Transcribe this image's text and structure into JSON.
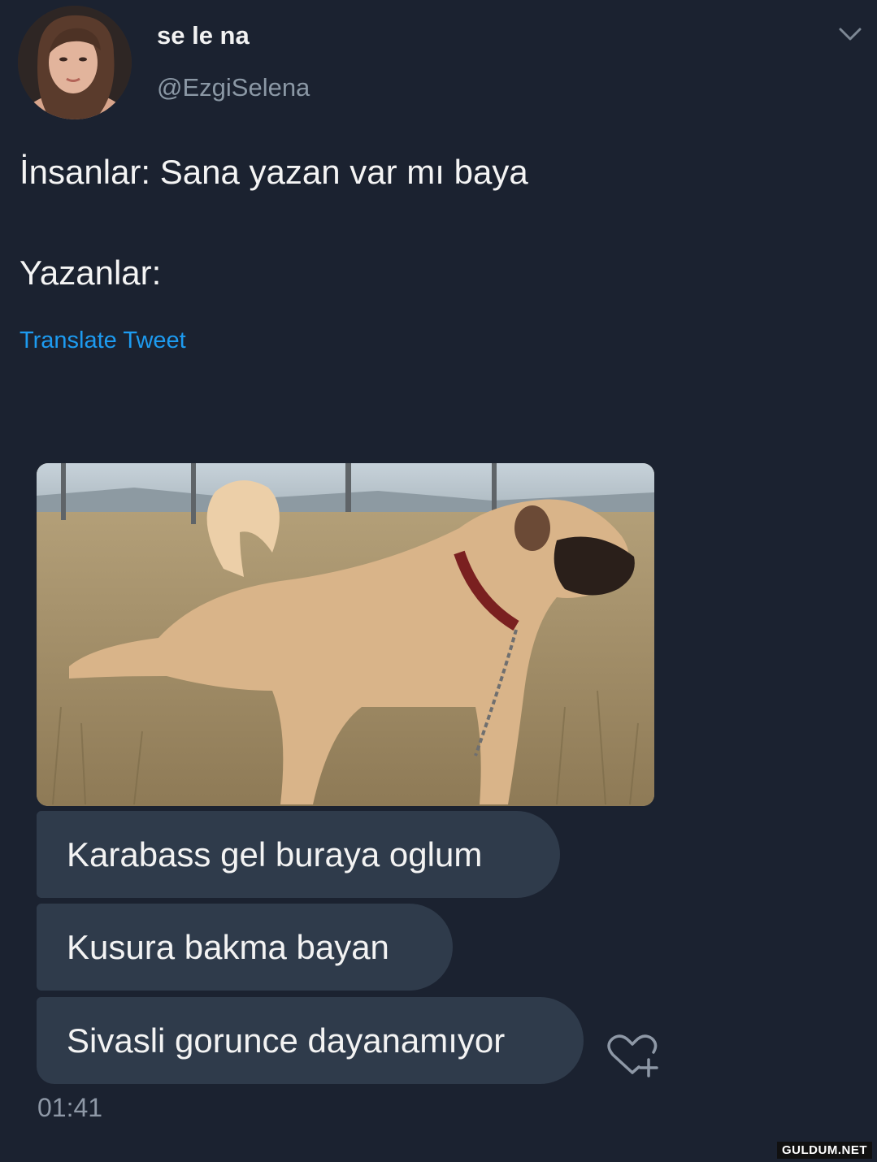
{
  "profile": {
    "display_name": "se le na",
    "handle": "@EzgiSelena"
  },
  "tweet": {
    "line1": "İnsanlar: Sana yazan var mı baya",
    "line2": "Yazanlar:",
    "translate_label": "Translate Tweet"
  },
  "chat": {
    "messages": [
      "Karabass gel buraya oglum",
      "Kusura bakma bayan",
      "Sivasli gorunce dayanamıyor"
    ],
    "timestamp": "01:41"
  },
  "watermark": "GULDUM.NET",
  "icons": {
    "menu": "chevron-down-icon",
    "reaction": "heart-plus-icon"
  },
  "colors": {
    "background": "#1b2230",
    "bubble": "#2f3b4b",
    "link": "#1d9bf0",
    "secondary_text": "#8b98a5"
  }
}
